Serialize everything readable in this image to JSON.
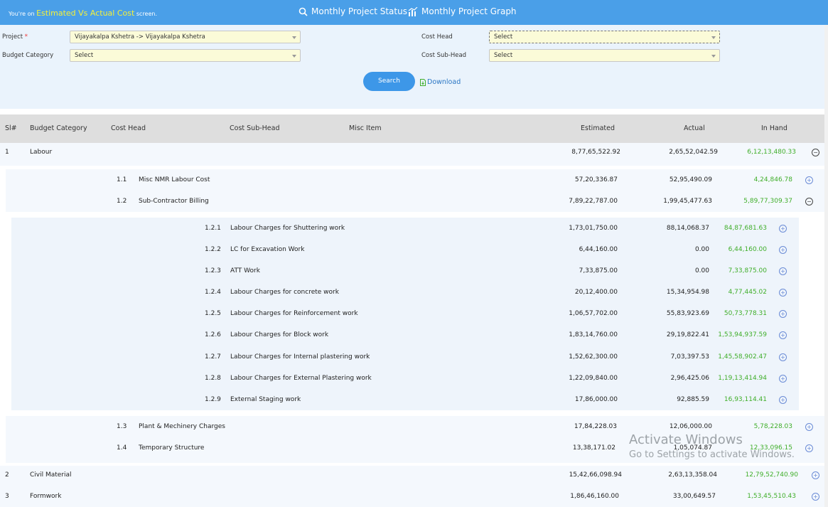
{
  "header": {
    "prefix": "You're on",
    "screen": "Estimated Vs Actual Cost",
    "suffix": "screen.",
    "nav_status": "Monthly Project Status",
    "nav_graph": "Monthly Project Graph"
  },
  "filters": {
    "project_label": "Project",
    "required_mark": "*",
    "project_value": "Vijayakalpa Kshetra -> Vijayakalpa Kshetra",
    "budget_category_label": "Budget Category",
    "budget_category_value": "Select",
    "cost_head_label": "Cost Head",
    "cost_head_value": "Select",
    "cost_subhead_label": "Cost Sub-Head",
    "cost_subhead_value": "Select",
    "search_label": "Search",
    "download_label": "Download"
  },
  "table": {
    "columns": {
      "sl": "Sl#",
      "budget_category": "Budget Category",
      "cost_head": "Cost Head",
      "cost_subhead": "Cost Sub-Head",
      "misc_item": "Misc Item",
      "estimated": "Estimated",
      "actual": "Actual",
      "in_hand": "In Hand"
    },
    "rows": [
      {
        "sl": "1",
        "name": "Labour",
        "estimated": "8,77,65,522.92",
        "actual": "2,65,52,042.59",
        "in_hand": "6,12,13,480.33",
        "toggle": "⊖"
      },
      {
        "sl": "1.1",
        "name": "Misc NMR Labour Cost",
        "estimated": "57,20,336.87",
        "actual": "52,95,490.09",
        "in_hand": "4,24,846.78",
        "toggle": "⊕"
      },
      {
        "sl": "1.2",
        "name": "Sub-Contractor Billing",
        "estimated": "7,89,22,787.00",
        "actual": "1,99,45,477.63",
        "in_hand": "5,89,77,309.37",
        "toggle": "⊖"
      },
      {
        "sl": "1.2.1",
        "name": "Labour Charges for Shuttering work",
        "estimated": "1,73,01,750.00",
        "actual": "88,14,068.37",
        "in_hand": "84,87,681.63",
        "toggle": "⊕"
      },
      {
        "sl": "1.2.2",
        "name": "LC for Excavation Work",
        "estimated": "6,44,160.00",
        "actual": "0.00",
        "in_hand": "6,44,160.00",
        "toggle": "⊕"
      },
      {
        "sl": "1.2.3",
        "name": "ATT Work",
        "estimated": "7,33,875.00",
        "actual": "0.00",
        "in_hand": "7,33,875.00",
        "toggle": "⊕"
      },
      {
        "sl": "1.2.4",
        "name": "Labour Charges for concrete work",
        "estimated": "20,12,400.00",
        "actual": "15,34,954.98",
        "in_hand": "4,77,445.02",
        "toggle": "⊕"
      },
      {
        "sl": "1.2.5",
        "name": "Labour Charges for Reinforcement work",
        "estimated": "1,06,57,702.00",
        "actual": "55,83,923.69",
        "in_hand": "50,73,778.31",
        "toggle": "⊕"
      },
      {
        "sl": "1.2.6",
        "name": "Labour Charges for Block work",
        "estimated": "1,83,14,760.00",
        "actual": "29,19,822.41",
        "in_hand": "1,53,94,937.59",
        "toggle": "⊕"
      },
      {
        "sl": "1.2.7",
        "name": "Labour Charges for Internal plastering work",
        "estimated": "1,52,62,300.00",
        "actual": "7,03,397.53",
        "in_hand": "1,45,58,902.47",
        "toggle": "⊕"
      },
      {
        "sl": "1.2.8",
        "name": "Labour Charges for External Plastering work",
        "estimated": "1,22,09,840.00",
        "actual": "2,96,425.06",
        "in_hand": "1,19,13,414.94",
        "toggle": "⊕"
      },
      {
        "sl": "1.2.9",
        "name": "External Staging work",
        "estimated": "17,86,000.00",
        "actual": "92,885.59",
        "in_hand": "16,93,114.41",
        "toggle": "⊕"
      },
      {
        "sl": "1.3",
        "name": "Plant & Mechinery Charges",
        "estimated": "17,84,228.03",
        "actual": "12,06,000.00",
        "in_hand": "5,78,228.03",
        "toggle": "⊕"
      },
      {
        "sl": "1.4",
        "name": "Temporary Structure",
        "estimated": "13,38,171.02",
        "actual": "1,05,074.87",
        "in_hand": "12,33,096.15",
        "toggle": "⊕"
      },
      {
        "sl": "2",
        "name": "Civil Material",
        "estimated": "15,42,66,098.94",
        "actual": "2,63,13,358.04",
        "in_hand": "12,79,52,740.90",
        "toggle": "⊕"
      },
      {
        "sl": "3",
        "name": "Formwork",
        "estimated": "1,86,46,160.00",
        "actual": "33,00,649.57",
        "in_hand": "1,53,45,510.43",
        "toggle": "⊕"
      }
    ]
  },
  "watermark": {
    "line1": "Activate Windows",
    "line2": "Go to Settings to activate Windows."
  },
  "colors": {
    "header_bg": "#4a9fe8",
    "highlight": "#f4f03a",
    "in_hand": "#3fae29",
    "filters_bg": "#eaf3fc"
  }
}
